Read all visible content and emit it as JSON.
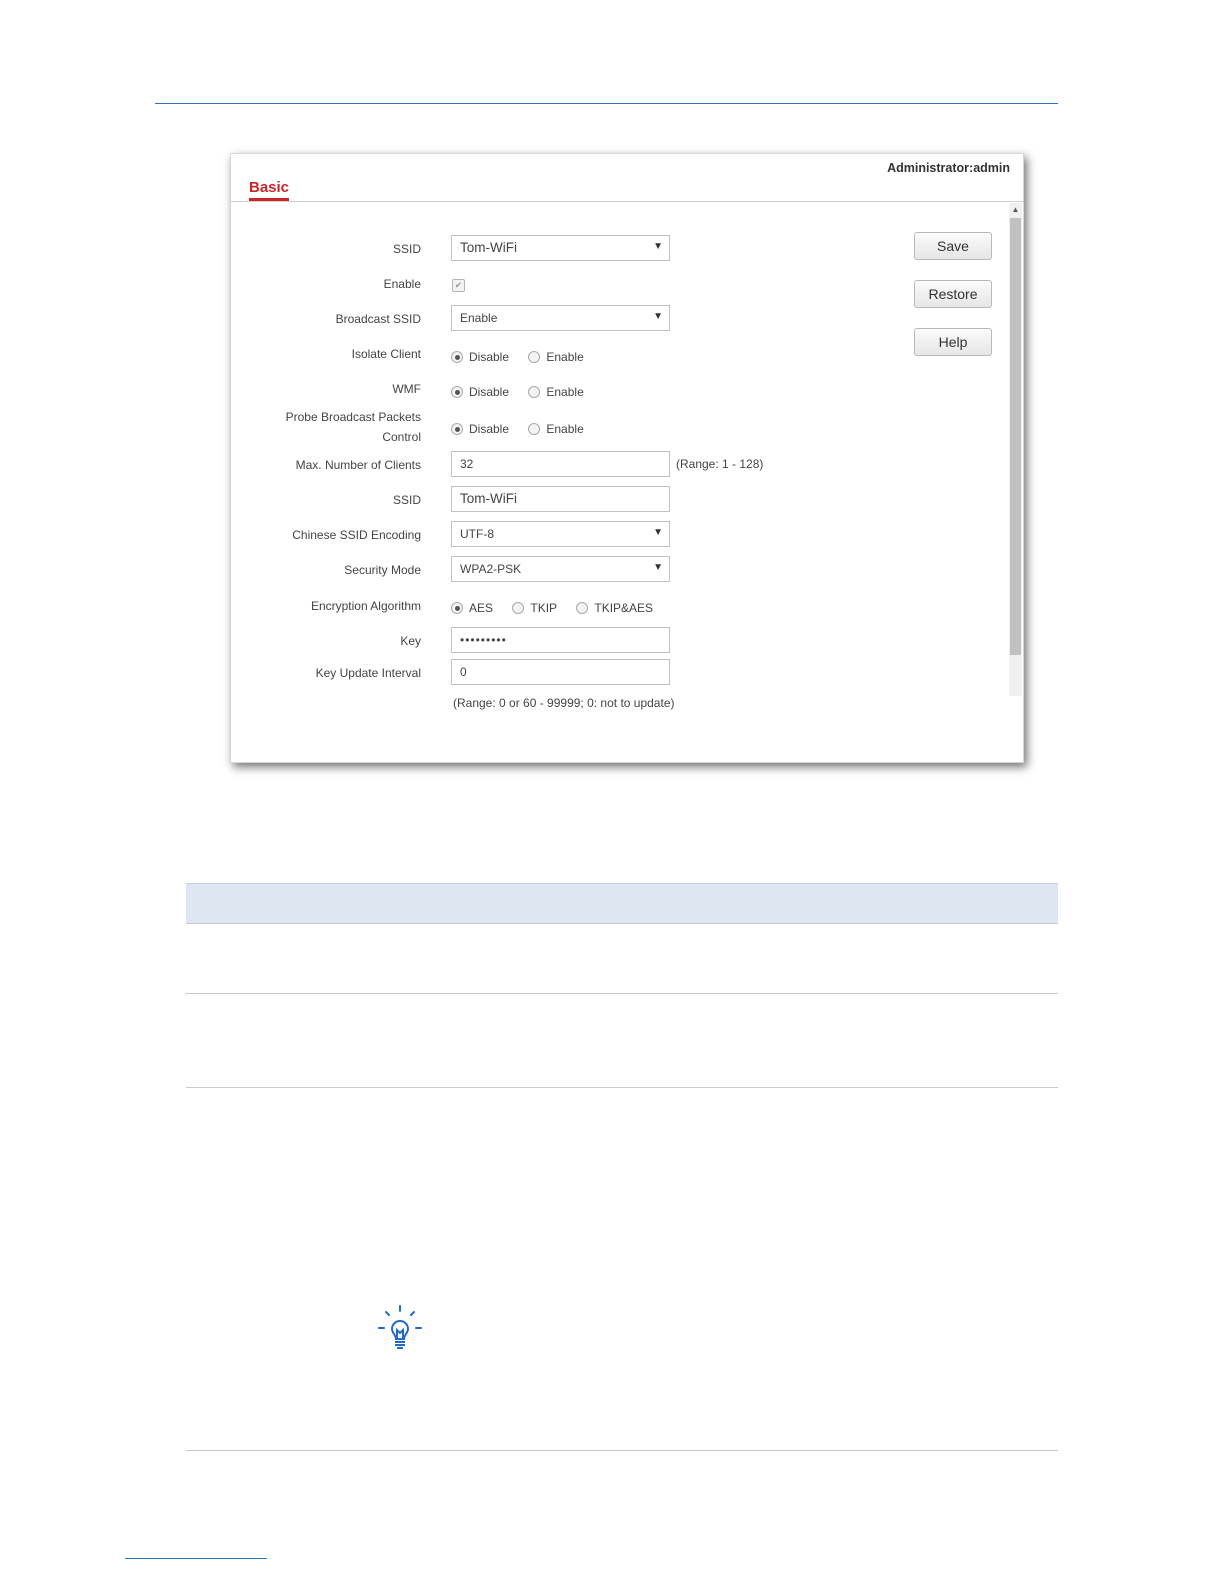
{
  "panel": {
    "admin_label": "Administrator:",
    "admin_user": "admin",
    "tab": "Basic"
  },
  "form": {
    "ssid_label": "SSID",
    "ssid_value": "Tom-WiFi",
    "enable_label": "Enable",
    "enable_checked": true,
    "broadcast_label": "Broadcast SSID",
    "broadcast_value": "Enable",
    "isolate_label": "Isolate Client",
    "wmf_label": "WMF",
    "probe_label_line1": "Probe Broadcast Packets",
    "probe_label_line2": "Control",
    "opt_disable": "Disable",
    "opt_enable": "Enable",
    "max_clients_label": "Max. Number of Clients",
    "max_clients_value": "32",
    "max_clients_range": "(Range: 1 - 128)",
    "ssid2_label": "SSID",
    "ssid2_value": "Tom-WiFi",
    "encoding_label": "Chinese SSID Encoding",
    "encoding_value": "UTF-8",
    "security_label": "Security Mode",
    "security_value": "WPA2-PSK",
    "algo_label": "Encryption Algorithm",
    "algo_aes": "AES",
    "algo_tkip": "TKIP",
    "algo_tkipaes": "TKIP&AES",
    "key_label": "Key",
    "key_value": "•••••••••",
    "interval_label": "Key Update Interval",
    "interval_value": "0",
    "interval_range": "(Range: 0 or 60 - 99999; 0: not to update)"
  },
  "buttons": {
    "save": "Save",
    "restore": "Restore",
    "help": "Help"
  },
  "icons": {
    "arrow": "▼",
    "check": "✔",
    "scroll_up": "▲",
    "tip": "lightbulb-icon"
  },
  "colors": {
    "accent_blue": "#2b73b6",
    "tab_red": "#c8262b",
    "table_header": "#dde6f1"
  }
}
